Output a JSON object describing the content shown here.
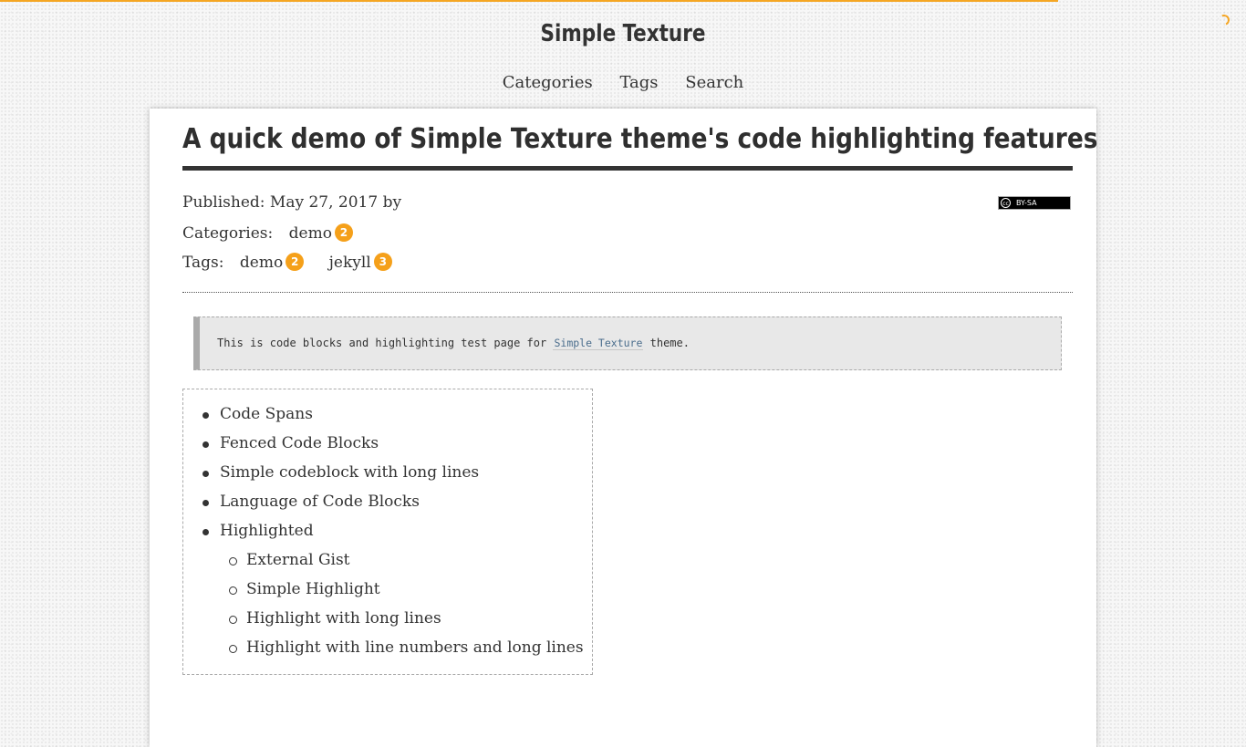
{
  "site": {
    "title": "Simple Texture"
  },
  "nav": {
    "items": [
      "Categories",
      "Tags",
      "Search"
    ]
  },
  "post": {
    "title": "A quick demo of Simple Texture theme's code highlighting features",
    "published_prefix": "Published:",
    "published_date": "May 27, 2017",
    "published_by": "by",
    "categories_label": "Categories:",
    "categories": [
      {
        "name": "demo",
        "count": "2"
      }
    ],
    "tags_label": "Tags:",
    "tags": [
      {
        "name": "demo",
        "count": "2"
      },
      {
        "name": "jekyll",
        "count": "3"
      }
    ],
    "license_badge": "BY-SA",
    "license_cc": "cc"
  },
  "quote": {
    "text_before": "This is code blocks and highlighting test page for ",
    "code": "Simple Texture",
    "text_after": " theme."
  },
  "toc": {
    "items": [
      "Code Spans",
      "Fenced Code Blocks",
      "Simple codeblock with long lines",
      "Language of Code Blocks",
      "Highlighted"
    ],
    "subitems": [
      "External Gist",
      "Simple Highlight",
      "Highlight with long lines",
      "Highlight with line numbers and long lines"
    ]
  },
  "colors": {
    "accent": "#f5a01a",
    "text": "#333333",
    "card": "#ffffff"
  }
}
